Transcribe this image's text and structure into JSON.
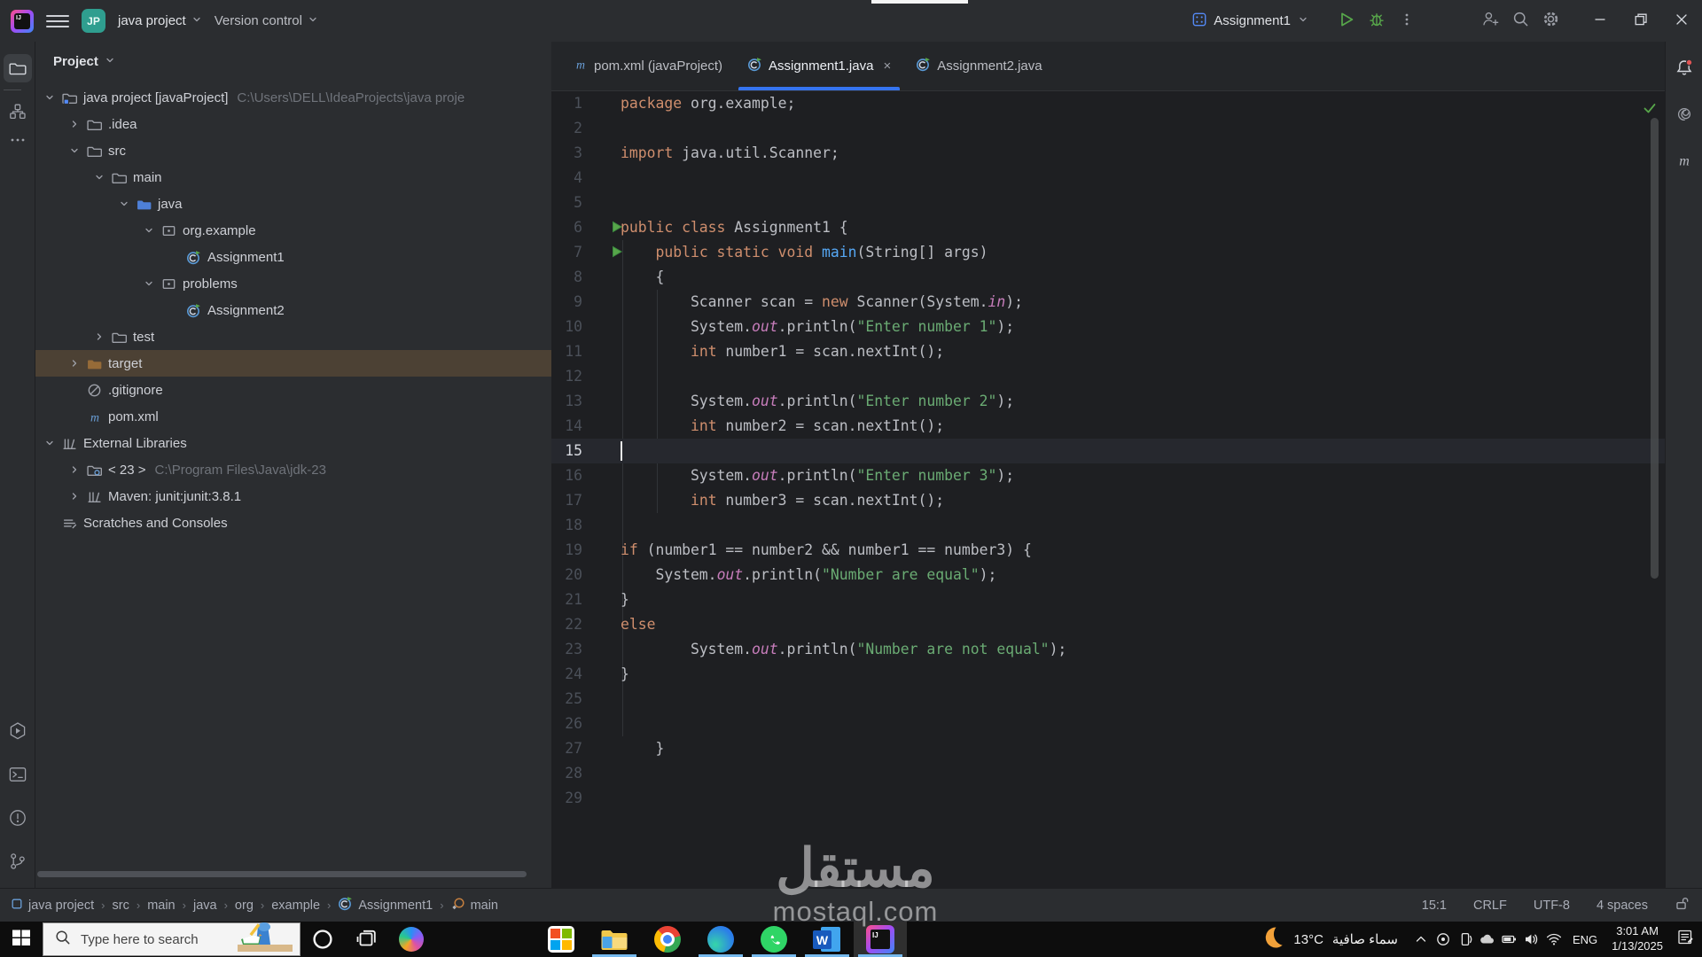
{
  "colors": {
    "accent": "#3574f0",
    "keyword": "#cf8e6d",
    "string": "#6aab73",
    "field": "#c77dbb",
    "method_decl": "#56a8f5",
    "code_text": "#bcbec4",
    "run_green": "#57a64a",
    "selection_brown": "#4c4134",
    "taskbar_indicator": "#76b9ed"
  },
  "titlebar": {
    "logo": "intellij-idea",
    "project_name": "java project",
    "version_control_label": "Version control",
    "project_avatar_initials": "JP",
    "run_config_name": "Assignment1"
  },
  "left_stripe": {
    "top": [
      {
        "icon": "folder-tool",
        "name": "project-tool",
        "active": true
      },
      {
        "icon": "divider"
      },
      {
        "icon": "structure",
        "name": "structure-tool"
      },
      {
        "icon": "dots",
        "name": "more-tool-windows"
      }
    ],
    "bottom": [
      {
        "icon": "services",
        "name": "services-tool"
      },
      {
        "icon": "terminal",
        "name": "terminal-tool"
      },
      {
        "icon": "problems",
        "name": "problems-tool"
      },
      {
        "icon": "git",
        "name": "git-tool"
      }
    ]
  },
  "project_panel": {
    "header": "Project",
    "items": [
      {
        "indent": 0,
        "chevron": "down",
        "icon": "project-folder",
        "label": "java project [javaProject]",
        "path": "C:\\Users\\DELL\\IdeaProjects\\java proje"
      },
      {
        "indent": 1,
        "chevron": "right",
        "icon": "folder",
        "label": ".idea"
      },
      {
        "indent": 1,
        "chevron": "down",
        "icon": "folder",
        "label": "src"
      },
      {
        "indent": 2,
        "chevron": "down",
        "icon": "folder",
        "label": "main"
      },
      {
        "indent": 3,
        "chevron": "down",
        "icon": "folder-java",
        "label": "java"
      },
      {
        "indent": 4,
        "chevron": "down",
        "icon": "package",
        "label": "org.example"
      },
      {
        "indent": 5,
        "chevron": "none",
        "icon": "class",
        "label": "Assignment1"
      },
      {
        "indent": 4,
        "chevron": "down",
        "icon": "package",
        "label": "problems"
      },
      {
        "indent": 5,
        "chevron": "none",
        "icon": "class",
        "label": "Assignment2"
      },
      {
        "indent": 2,
        "chevron": "right",
        "icon": "folder",
        "label": "test"
      },
      {
        "indent": 1,
        "chevron": "right",
        "icon": "folder-excluded",
        "label": "target",
        "selected": true
      },
      {
        "indent": 1,
        "chevron": "none",
        "icon": "ignored",
        "label": ".gitignore"
      },
      {
        "indent": 1,
        "chevron": "none",
        "icon": "maven",
        "label": "pom.xml"
      },
      {
        "indent": 0,
        "chevron": "down",
        "icon": "library",
        "label": "External Libraries"
      },
      {
        "indent": 1,
        "chevron": "right",
        "icon": "jdk",
        "label": "< 23 >",
        "path": "C:\\Program Files\\Java\\jdk-23"
      },
      {
        "indent": 1,
        "chevron": "right",
        "icon": "library",
        "label": "Maven: junit:junit:3.8.1"
      },
      {
        "indent": 0,
        "chevron": "none",
        "icon": "scratches",
        "label": "Scratches and Consoles"
      }
    ]
  },
  "tabs": [
    {
      "icon": "maven",
      "label": "pom.xml (javaProject)",
      "active": false,
      "closable": false
    },
    {
      "icon": "class",
      "label": "Assignment1.java",
      "active": true,
      "closable": true
    },
    {
      "icon": "class",
      "label": "Assignment2.java",
      "active": false,
      "closable": false
    }
  ],
  "editor": {
    "caret_line": 15,
    "lines": [
      {
        "n": 1,
        "tokens": [
          [
            "k",
            "package"
          ],
          [
            "d",
            " org.example;"
          ]
        ]
      },
      {
        "n": 2,
        "tokens": []
      },
      {
        "n": 3,
        "tokens": [
          [
            "k",
            "import"
          ],
          [
            "d",
            " java.util.Scanner;"
          ]
        ]
      },
      {
        "n": 4,
        "tokens": []
      },
      {
        "n": 5,
        "tokens": []
      },
      {
        "n": 6,
        "run": true,
        "tokens": [
          [
            "k",
            "public class"
          ],
          [
            "d",
            " Assignment1 {"
          ]
        ]
      },
      {
        "n": 7,
        "run": true,
        "tokens": [
          [
            "d",
            "    "
          ],
          [
            "k",
            "public static void"
          ],
          [
            "d",
            " "
          ],
          [
            "m",
            "main"
          ],
          [
            "d",
            "(String[] args)"
          ]
        ]
      },
      {
        "n": 8,
        "tokens": [
          [
            "d",
            "    {"
          ]
        ]
      },
      {
        "n": 9,
        "tokens": [
          [
            "d",
            "        Scanner scan = "
          ],
          [
            "k",
            "new"
          ],
          [
            "d",
            " Scanner(System."
          ],
          [
            "f",
            "in"
          ],
          [
            "d",
            ");"
          ]
        ]
      },
      {
        "n": 10,
        "tokens": [
          [
            "d",
            "        System."
          ],
          [
            "f",
            "out"
          ],
          [
            "d",
            ".println("
          ],
          [
            "s",
            "\"Enter number 1\""
          ],
          [
            "d",
            ");"
          ]
        ]
      },
      {
        "n": 11,
        "tokens": [
          [
            "d",
            "        "
          ],
          [
            "k",
            "int"
          ],
          [
            "d",
            " number1 = scan.nextInt();"
          ]
        ]
      },
      {
        "n": 12,
        "tokens": []
      },
      {
        "n": 13,
        "tokens": [
          [
            "d",
            "        System."
          ],
          [
            "f",
            "out"
          ],
          [
            "d",
            ".println("
          ],
          [
            "s",
            "\"Enter number 2\""
          ],
          [
            "d",
            ");"
          ]
        ]
      },
      {
        "n": 14,
        "tokens": [
          [
            "d",
            "        "
          ],
          [
            "k",
            "int"
          ],
          [
            "d",
            " number2 = scan.nextInt();"
          ]
        ]
      },
      {
        "n": 15,
        "current": true,
        "tokens": []
      },
      {
        "n": 16,
        "tokens": [
          [
            "d",
            "        System."
          ],
          [
            "f",
            "out"
          ],
          [
            "d",
            ".println("
          ],
          [
            "s",
            "\"Enter number 3\""
          ],
          [
            "d",
            ");"
          ]
        ]
      },
      {
        "n": 17,
        "tokens": [
          [
            "d",
            "        "
          ],
          [
            "k",
            "int"
          ],
          [
            "d",
            " number3 = scan.nextInt();"
          ]
        ]
      },
      {
        "n": 18,
        "tokens": []
      },
      {
        "n": 19,
        "tokens": [
          [
            "k",
            "if"
          ],
          [
            "d",
            " (number1 == number2 && number1 == number3) {"
          ]
        ]
      },
      {
        "n": 20,
        "tokens": [
          [
            "d",
            "    System."
          ],
          [
            "f",
            "out"
          ],
          [
            "d",
            ".println("
          ],
          [
            "s",
            "\"Number are equal\""
          ],
          [
            "d",
            ");"
          ]
        ]
      },
      {
        "n": 21,
        "tokens": [
          [
            "d",
            "}"
          ]
        ]
      },
      {
        "n": 22,
        "tokens": [
          [
            "k",
            "else"
          ]
        ]
      },
      {
        "n": 23,
        "tokens": [
          [
            "d",
            "        System."
          ],
          [
            "f",
            "out"
          ],
          [
            "d",
            ".println("
          ],
          [
            "s",
            "\"Number are not equal\""
          ],
          [
            "d",
            ");"
          ]
        ]
      },
      {
        "n": 24,
        "tokens": [
          [
            "d",
            "}"
          ]
        ]
      },
      {
        "n": 25,
        "tokens": []
      },
      {
        "n": 26,
        "tokens": []
      },
      {
        "n": 27,
        "tokens": [
          [
            "d",
            "    }"
          ]
        ]
      },
      {
        "n": 28,
        "tokens": []
      },
      {
        "n": 29,
        "tokens": []
      }
    ]
  },
  "right_stripe": [
    {
      "icon": "bell",
      "badge": true,
      "name": "notifications"
    },
    {
      "icon": "ai",
      "name": "ai-assistant"
    },
    {
      "icon": "maven-m",
      "name": "maven-panel"
    }
  ],
  "status_bar": {
    "breadcrumbs": [
      {
        "icon": "project-chip",
        "label": "java project"
      },
      {
        "label": "src"
      },
      {
        "label": "main"
      },
      {
        "label": "java"
      },
      {
        "label": "org"
      },
      {
        "label": "example"
      },
      {
        "icon": "class",
        "label": "Assignment1"
      },
      {
        "icon": "method",
        "label": "main"
      }
    ],
    "right_items": [
      "15:1",
      "CRLF",
      "UTF-8",
      "4 spaces"
    ],
    "lock_icon": "unlocked"
  },
  "taskbar": {
    "search_placeholder": "Type here to search",
    "pinned": [
      {
        "icon": "cortana",
        "name": "cortana"
      },
      {
        "icon": "taskview",
        "name": "task-view"
      },
      {
        "icon": "copilot",
        "name": "copilot"
      }
    ],
    "apps": [
      {
        "icon": "m365",
        "name": "microsoft-365",
        "indicator": false,
        "active": false
      },
      {
        "icon": "explorer",
        "name": "file-explorer",
        "indicator": true,
        "active": false
      },
      {
        "icon": "chrome",
        "name": "chrome",
        "indicator": false,
        "active": false
      },
      {
        "icon": "edge",
        "name": "edge",
        "indicator": true,
        "active": false
      },
      {
        "icon": "whatsapp",
        "name": "whatsapp",
        "indicator": true,
        "active": false
      },
      {
        "icon": "word",
        "name": "word",
        "indicator": true,
        "active": false
      },
      {
        "icon": "intellij",
        "name": "intellij-idea",
        "indicator": true,
        "active": true
      }
    ],
    "weather": {
      "temp": "13°C",
      "description": "سماء صافية"
    },
    "tray_icons": [
      "chevron-up",
      "record",
      "phone",
      "cloud",
      "battery",
      "speaker",
      "wifi"
    ],
    "language": "ENG",
    "time": "3:01 AM",
    "date": "1/13/2025"
  },
  "watermark": {
    "arabic": "مستقل",
    "latin": "mostaql.com"
  }
}
